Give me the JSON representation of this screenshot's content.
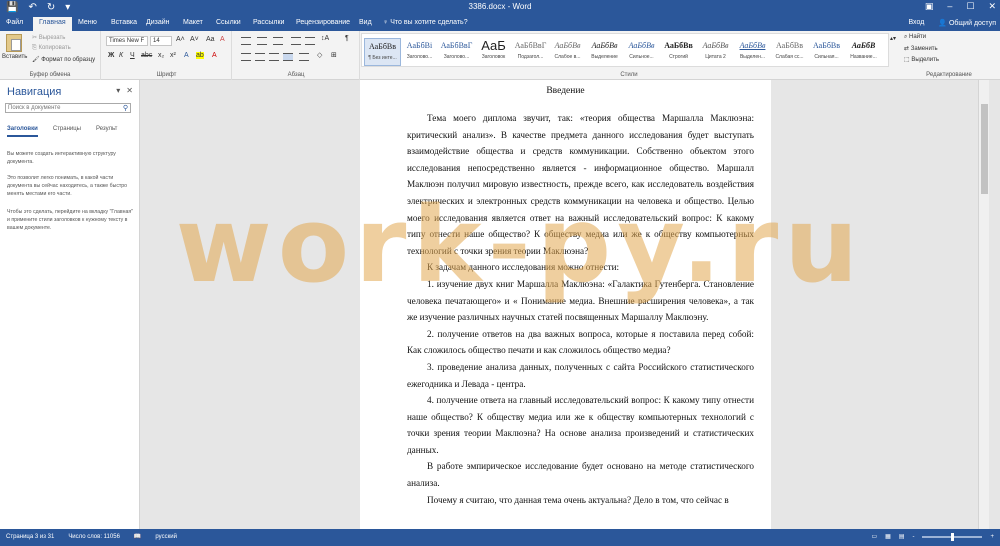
{
  "titlebar": {
    "doc_title": "3386.docx - Word",
    "qat": [
      "save-icon",
      "undo-icon",
      "redo-icon",
      "customize-icon"
    ],
    "window_controls": [
      "–",
      "☐",
      "✕"
    ]
  },
  "tabs": {
    "items": [
      "Файл",
      "Главная",
      "Меню",
      "Вставка",
      "Дизайн",
      "Макет",
      "Ссылки",
      "Рассылки",
      "Рецензирование",
      "Вид"
    ],
    "tellme": "Что вы хотите сделать?",
    "signin": "Вход",
    "share": "Общий доступ"
  },
  "ribbon": {
    "clipboard": {
      "paste": "Вставить",
      "cut": "Вырезать",
      "copy": "Копировать",
      "format": "Формат по образцу",
      "label": "Буфер обмена"
    },
    "font": {
      "name": "Times New F",
      "size": "14",
      "label": "Шрифт"
    },
    "paragraph": {
      "label": "Абзац"
    },
    "styles": {
      "label": "Стили",
      "items": [
        {
          "preview": "АаБбВв",
          "name": "¶ Без инте..."
        },
        {
          "preview": "АаБбВі",
          "name": "Заголово..."
        },
        {
          "preview": "АаБбВвГ",
          "name": "Заголово..."
        },
        {
          "preview": "АаБ",
          "name": "Заголовок"
        },
        {
          "preview": "АаБбВвГ",
          "name": "Подзагол..."
        },
        {
          "preview": "АаБбВв",
          "name": "Слабое в..."
        },
        {
          "preview": "АаБбВв",
          "name": "Выделение"
        },
        {
          "preview": "АаБбВв",
          "name": "Сильное..."
        },
        {
          "preview": "АаБбВв",
          "name": "Строгий"
        },
        {
          "preview": "АаБбВв",
          "name": "Цитата 2"
        },
        {
          "preview": "АаБбВв",
          "name": "Выделен..."
        },
        {
          "preview": "АаБбВв",
          "name": "Слабая сс..."
        },
        {
          "preview": "АаБбВв",
          "name": "Сильная..."
        },
        {
          "preview": "АаБбВ",
          "name": "Название..."
        }
      ]
    },
    "editing": {
      "find": "Найти",
      "replace": "Заменить",
      "select": "Выделить",
      "label": "Редактирование"
    }
  },
  "nav": {
    "title": "Навигация",
    "search_placeholder": "Поиск в документе",
    "tabs": [
      "Заголовки",
      "Страницы",
      "Результ"
    ],
    "text1": "Вы можете создать интерактивную структуру документа.",
    "text2": "Это позволит легко понимать, в какой части документа вы сейчас находитесь, а также быстро менять местами его части.",
    "text3": "Чтобы это сделать, перейдите на вкладку \"Главная\" и примените стили заголовков к нужному тексту в вашем документе."
  },
  "document": {
    "heading": "Введение",
    "paragraphs": [
      "Тема моего диплома звучит, так: «теория общества Маршалла Маклюэна: критический анализ». В качестве предмета данного исследования будет выступать взаимодействие общества и средств коммуникации. Собственно объектом этого исследования непосредственно является - информационное общество. Маршалл Маклюэн получил мировую известность, прежде всего, как исследователь воздействия электрических и электронных средств коммуникации на человека и общество. Целью моего исследования является ответ на важный исследовательский вопрос: К какому типу отнести наше общество? К обществу медиа или же к обществу компьютерных технологий с точки зрения теории Маклюэна?",
      "К задачам данного исследования можно отнести:",
      "1. изучение двух книг Маршалла Маклюэна: «Галактика Гутенберга. Становление человека печатающего» и « Понимание медиа. Внешние расширения человека», а так же изучение различных научных статей посвященных Маршаллу Маклюэну.",
      "2. получение ответов на два важных вопроса, которые я поставила перед собой: Как сложилось общество печати и как сложилось общество медиа?",
      "3. проведение анализа данных, полученных с сайта Российского статистического ежегодника и Левада - центра.",
      "4. получение ответа на главный исследовательский вопрос: К какому типу отнести наше общество? К обществу медиа или же к обществу компьютерных технологий с точки зрения теории Маклюэна? На основе анализа произведений и статистических данных.",
      "В работе эмпирическое исследование будет основано на методе статистического анализа.",
      "Почему я считаю, что данная тема очень актуальна? Дело в том, что сейчас в"
    ]
  },
  "watermark": "work-py.ru",
  "status": {
    "page": "Страница 3 из 31",
    "words": "Число слов: 11056",
    "lang": "русский",
    "zoom_minus": "-",
    "zoom_plus": "+"
  }
}
